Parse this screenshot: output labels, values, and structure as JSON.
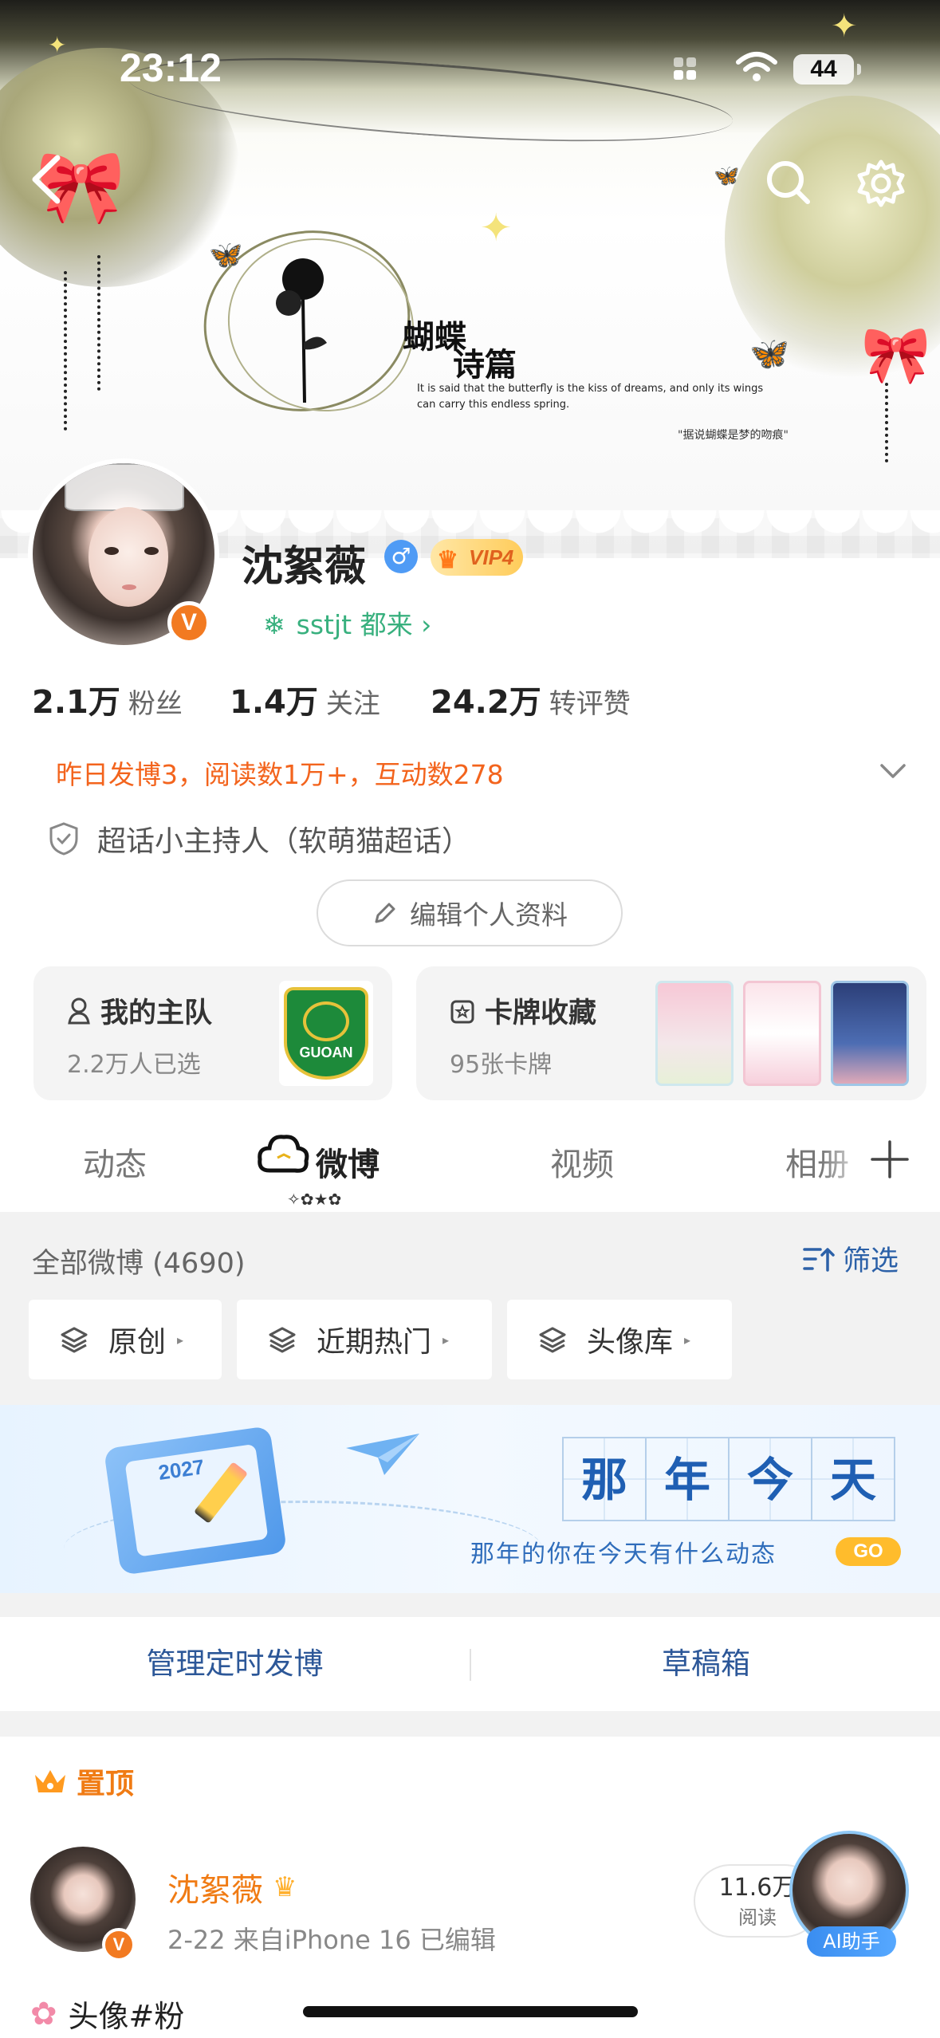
{
  "status_bar": {
    "time": "23:12",
    "battery": "44"
  },
  "cover": {
    "title_line1": "蝴蝶",
    "title_line2": "诗篇",
    "subtitle_en": "It is said that the butterfly is the kiss of dreams, and only its wings can carry this endless spring.",
    "quote": "\"据说蝴蝶是梦的吻痕\""
  },
  "profile": {
    "name": "沈絮薇",
    "gender_symbol": "♂",
    "vip_label": "VIP4",
    "verified_mark": "V",
    "group_link": "sstjt 都来 ›",
    "stats": [
      {
        "value": "2.1万",
        "label": "粉丝"
      },
      {
        "value": "1.4万",
        "label": "关注"
      },
      {
        "value": "24.2万",
        "label": "转评赞"
      }
    ],
    "activity": "昨日发博3，阅读数1万+，互动数278",
    "host_role": "超话小主持人（软萌猫超话）",
    "edit_button": "编辑个人资料"
  },
  "cards": {
    "team": {
      "title": "我的主队",
      "subtitle": "2.2万人已选",
      "club_short": "GUOAN"
    },
    "collection": {
      "title": "卡牌收藏",
      "subtitle": "95张卡牌"
    }
  },
  "tabs": [
    {
      "label": "动态",
      "active": false
    },
    {
      "label": "微博",
      "active": true
    },
    {
      "label": "视频",
      "active": false
    },
    {
      "label": "相册",
      "active": false
    }
  ],
  "feed": {
    "count_label": "全部微博 (4690)",
    "filter_label": "筛选",
    "chips": [
      "原创",
      "近期热门",
      "头像库"
    ]
  },
  "banner": {
    "year": "2027",
    "chars": [
      "那",
      "年",
      "今",
      "天"
    ],
    "subtitle": "那年的你在今天有什么动态",
    "go_label": "GO"
  },
  "manage": {
    "scheduled": "管理定时发博",
    "drafts": "草稿箱"
  },
  "pinned_post": {
    "pin_label": "置顶",
    "author": "沈絮薇",
    "meta": "2-22  来自iPhone 16  已编辑",
    "text": "头像#粉",
    "reads_value": "11.6万",
    "reads_label": "阅读",
    "ai_label": "AI助手"
  },
  "colors": {
    "accent_orange": "#f3641d",
    "link_blue": "#2c61a8",
    "group_green": "#38b07e",
    "vip_gold": "#ffcc5a"
  }
}
